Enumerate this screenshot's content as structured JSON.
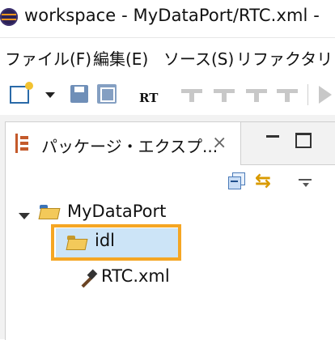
{
  "window": {
    "title": "workspace - MyDataPort/RTC.xml - "
  },
  "menubar": {
    "items": [
      "ファイル(F)",
      "編集(E)",
      "ソース(S)",
      "リファクタリン"
    ]
  },
  "toolbar": {
    "rt_label": "RT"
  },
  "view": {
    "tab_label": "パッケージ・エクスプ...",
    "close_glyph": "⨯"
  },
  "tree": {
    "project": "MyDataPort",
    "folder": "idl",
    "file": "RTC.xml"
  },
  "colors": {
    "accent_callout": "#f5a623",
    "selection": "#cce4f7"
  }
}
